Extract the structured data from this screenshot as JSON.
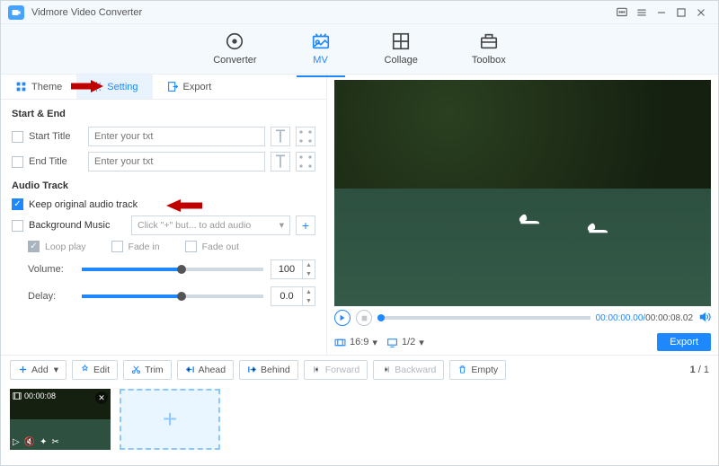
{
  "app": {
    "title": "Vidmore Video Converter"
  },
  "nav": {
    "converter": "Converter",
    "mv": "MV",
    "collage": "Collage",
    "toolbox": "Toolbox"
  },
  "subtabs": {
    "theme": "Theme",
    "setting": "Setting",
    "export": "Export"
  },
  "settings": {
    "start_end_h": "Start & End",
    "start_title": "Start Title",
    "end_title": "End Title",
    "placeholder": "Enter your txt",
    "audio_h": "Audio Track",
    "keep_original": "Keep original audio track",
    "bg_music": "Background Music",
    "bg_music_ph": "Click \"+\" but... to add audio",
    "loop": "Loop play",
    "fadein": "Fade in",
    "fadeout": "Fade out",
    "volume_lbl": "Volume:",
    "volume_val": "100",
    "delay_lbl": "Delay:",
    "delay_val": "0.0"
  },
  "player": {
    "current": "00:00:00.00",
    "duration": "00:00:08.02",
    "aspect": "16:9",
    "scale": "1/2"
  },
  "export_btn": "Export",
  "toolbar": {
    "add": "Add",
    "edit": "Edit",
    "trim": "Trim",
    "ahead": "Ahead",
    "behind": "Behind",
    "forward": "Forward",
    "backward": "Backward",
    "empty": "Empty"
  },
  "pager": {
    "cur": "1",
    "total": "1"
  },
  "thumb": {
    "dur": "00:00:08"
  }
}
